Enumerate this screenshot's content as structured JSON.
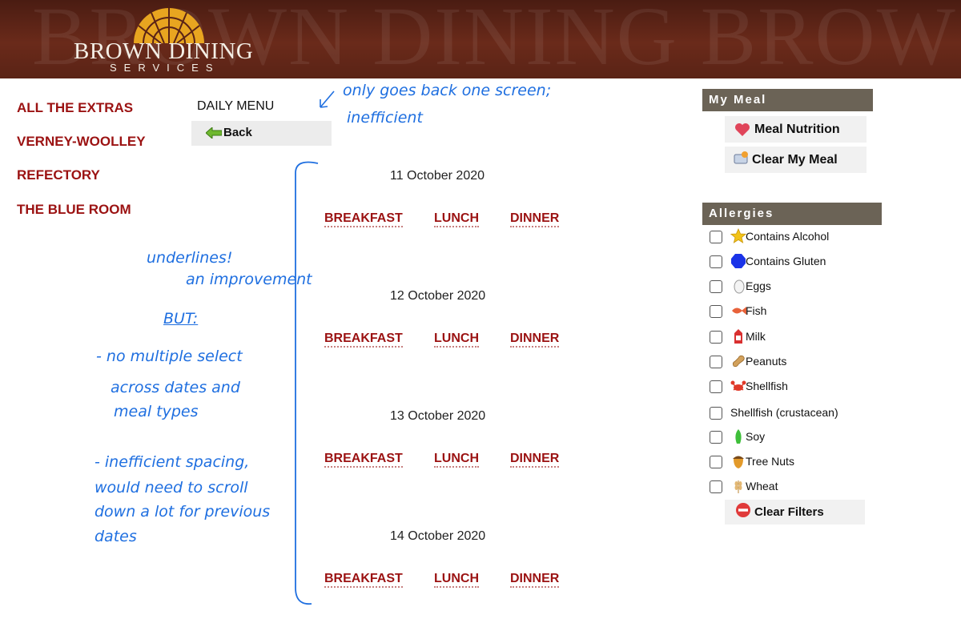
{
  "header": {
    "watermark": "BROWN DINING BROW",
    "logo_title": "BROWN DINING",
    "logo_subtitle": "SERVICES"
  },
  "nav": {
    "items": [
      {
        "label": "ALL THE EXTRAS"
      },
      {
        "label": "VERNEY-WOOLLEY"
      },
      {
        "label": "REFECTORY"
      },
      {
        "label": "THE BLUE ROOM"
      }
    ]
  },
  "menu": {
    "heading": "DAILY MENU",
    "back_label": "Back",
    "meal_labels": [
      "BREAKFAST",
      "LUNCH",
      "DINNER"
    ],
    "dates": [
      {
        "label": "11 October 2020"
      },
      {
        "label": "12 October 2020"
      },
      {
        "label": "13 October 2020"
      },
      {
        "label": "14 October 2020"
      }
    ]
  },
  "my_meal": {
    "heading": "My Meal",
    "nutrition_label": "Meal Nutrition",
    "clear_label": "Clear My Meal"
  },
  "allergies": {
    "heading": "Allergies",
    "items": [
      {
        "label": "Contains Alcohol",
        "icon": "star-icon"
      },
      {
        "label": "Contains Gluten",
        "icon": "blue-hexagon-icon"
      },
      {
        "label": "Eggs",
        "icon": "egg-icon"
      },
      {
        "label": "Fish",
        "icon": "fish-icon"
      },
      {
        "label": "Milk",
        "icon": "milk-carton-icon"
      },
      {
        "label": "Peanuts",
        "icon": "peanut-icon"
      },
      {
        "label": "Shellfish",
        "icon": "crab-icon"
      },
      {
        "label": "Shellfish (crustacean)",
        "icon": ""
      },
      {
        "label": "Soy",
        "icon": "soy-leaf-icon"
      },
      {
        "label": "Tree Nuts",
        "icon": "acorn-icon"
      },
      {
        "label": "Wheat",
        "icon": "wheat-icon"
      }
    ],
    "clear_filters_label": "Clear Filters"
  },
  "annotations": {
    "back_note_1": "only goes back one screen;",
    "back_note_2": "inefficient",
    "underline_note_1": "underlines!",
    "underline_note_2": "an improvement",
    "but_note": "BUT:",
    "multi_note_1": "- no multiple select",
    "multi_note_2": "across dates and",
    "multi_note_3": "meal types",
    "spacing_note_1": "- inefficient spacing,",
    "spacing_note_2": "would need to scroll",
    "spacing_note_3": "down a lot for previous",
    "spacing_note_4": "dates"
  },
  "colors": {
    "header_bg": "#5a2316",
    "nav_red": "#9b1212",
    "panel_head": "#6b6356",
    "annotation_blue": "#1f6fe0"
  }
}
